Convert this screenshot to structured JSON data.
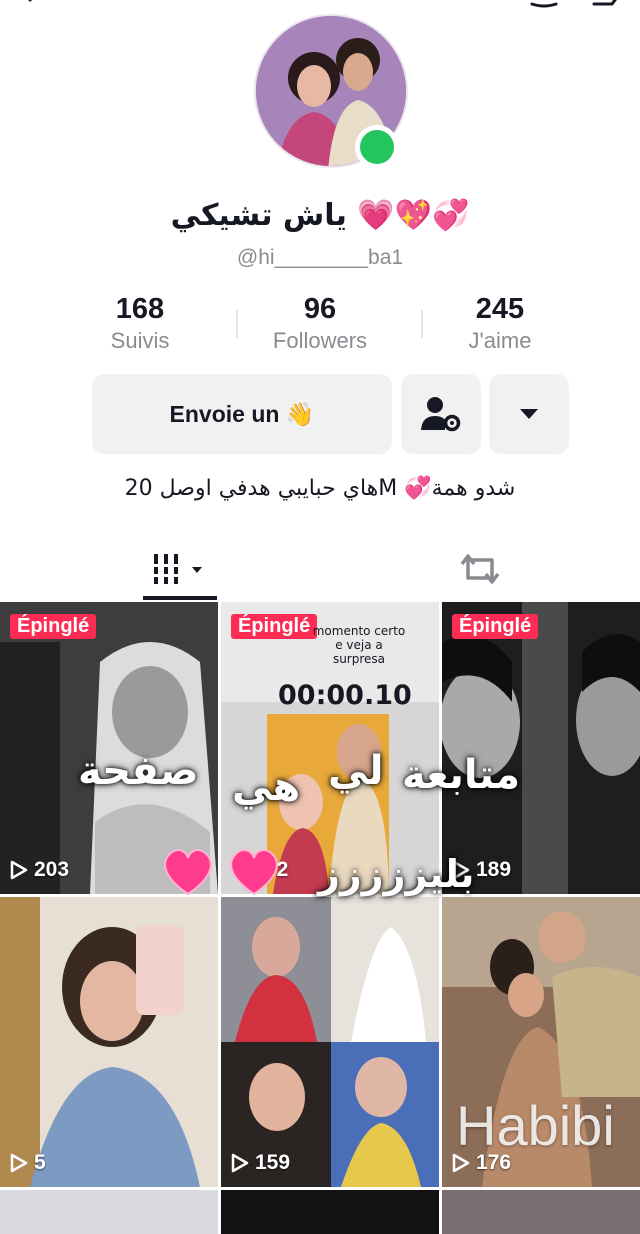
{
  "profile": {
    "display_name": "ياش تشيكي 💗💖💞",
    "username": "@hi________ba1",
    "online": true,
    "bio": "هاي حبايبي هدفي اوصل 20M 💞شدو همة"
  },
  "stats": [
    {
      "value": "168",
      "label": "Suivis"
    },
    {
      "value": "96",
      "label": "Followers"
    },
    {
      "value": "245",
      "label": "J'aime"
    }
  ],
  "actions": {
    "message_label": "Envoie un 👋"
  },
  "grid": {
    "pinned_label": "Épinglé",
    "overlay_word_1": "صفحة",
    "overlay_word_2": "هي",
    "overlay_word_3": "لي",
    "overlay_word_4": "متابعة",
    "overlay_word_5": "بليززززز",
    "tile2_caption": "momento certo e veja a surpresa",
    "tile2_timer": "00:00.10",
    "tile6_caption": "Habibi",
    "tiles": [
      {
        "views": "203",
        "pinned": true
      },
      {
        "views": "72",
        "pinned": true
      },
      {
        "views": "189",
        "pinned": true
      },
      {
        "views": "5",
        "pinned": false
      },
      {
        "views": "159",
        "pinned": false
      },
      {
        "views": "176",
        "pinned": false
      }
    ]
  },
  "colors": {
    "accent": "#fe2c55",
    "online": "#22c55e",
    "muted_text": "#8a8b91"
  }
}
